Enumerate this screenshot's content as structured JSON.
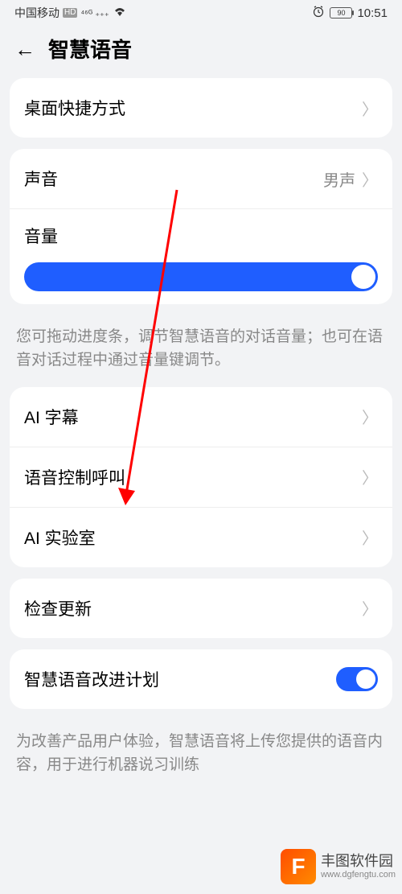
{
  "status_bar": {
    "carrier": "中国移动",
    "hd": "HD",
    "signal": "⁴⁶ ᴳ ⁌₁₁",
    "wifi": "≋",
    "alarm": "⏰",
    "battery": "90",
    "time": "10:51"
  },
  "header": {
    "title": "智慧语音"
  },
  "group1": {
    "shortcut": "桌面快捷方式"
  },
  "group2": {
    "voice_label": "声音",
    "voice_value": "男声",
    "volume_label": "音量"
  },
  "volume_hint": "您可拖动进度条，调节智慧语音的对话音量；也可在语音对话过程中通过音量键调节。",
  "group3": {
    "ai_subtitle": "AI 字幕",
    "voice_call": "语音控制呼叫",
    "ai_lab": "AI 实验室"
  },
  "group4": {
    "check_update": "检查更新"
  },
  "group5": {
    "improve_plan": "智慧语音改进计划"
  },
  "improve_hint": "为改善产品用户体验，智慧语音将上传您提供的语音内容，用于进行机器说习训练",
  "watermark": {
    "name": "丰图软件园",
    "url": "www.dgfengtu.com",
    "logo": "F"
  }
}
